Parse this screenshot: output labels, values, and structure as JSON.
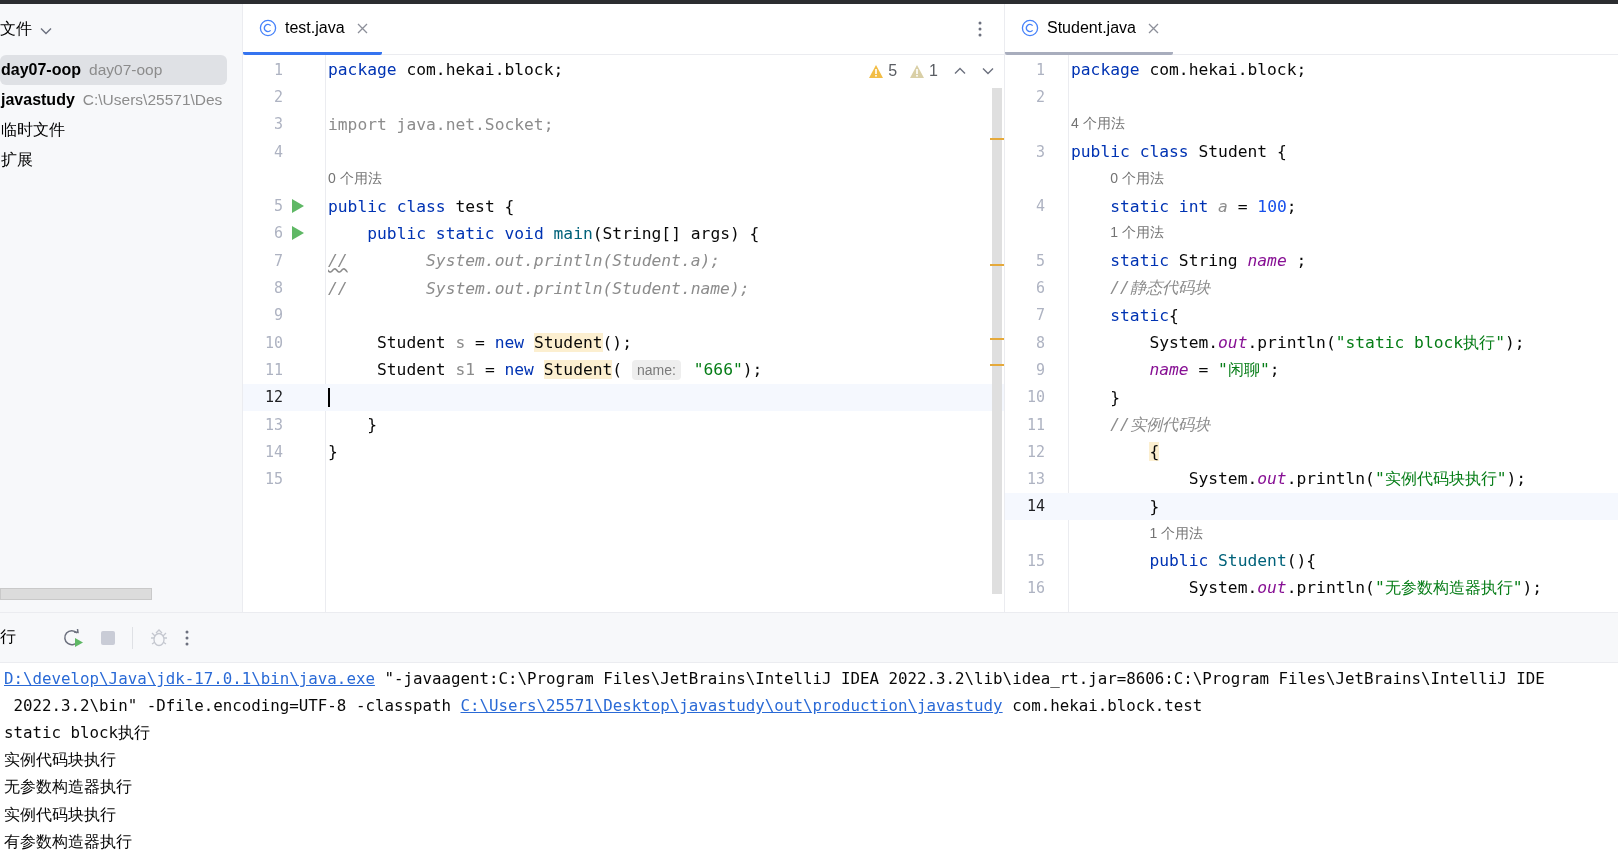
{
  "sidebar": {
    "title": "文件",
    "items": [
      {
        "name": "day07-oop",
        "detail": "day07-oop",
        "selected": true
      },
      {
        "name": "javastudy",
        "detail": "C:\\Users\\25571\\Des",
        "selected": false
      },
      {
        "name": "临时文件",
        "selected": false
      },
      {
        "name": "扩展",
        "selected": false
      }
    ]
  },
  "editors": [
    {
      "tab": {
        "label": "test.java",
        "focused": true
      },
      "inspections": {
        "warnings": "5",
        "weak_warnings": "1"
      },
      "lines": [
        {
          "kind": "code",
          "number": "1",
          "run": false,
          "current": false,
          "tokens": [
            {
              "kind": "keyword",
              "text": "package"
            },
            {
              "kind": "plain",
              "text": " com.hekai.block;"
            }
          ]
        },
        {
          "kind": "code",
          "number": "2",
          "run": false,
          "current": false
        },
        {
          "kind": "code",
          "number": "3",
          "run": false,
          "current": false,
          "tokens": [
            {
              "kind": "unused",
              "text": "import java.net.Socket;"
            }
          ]
        },
        {
          "kind": "code",
          "number": "4",
          "run": false,
          "current": false
        },
        {
          "kind": "usage",
          "text": "0 个用法"
        },
        {
          "kind": "code",
          "number": "5",
          "run": true,
          "current": false,
          "tokens": [
            {
              "kind": "keyword",
              "text": "public"
            },
            {
              "kind": "keyword",
              "text": " class"
            },
            {
              "kind": "plain",
              "text": " test {"
            }
          ]
        },
        {
          "kind": "code",
          "number": "6",
          "run": true,
          "current": false,
          "tokens": [
            {
              "kind": "keyword",
              "text": "    public"
            },
            {
              "kind": "keyword",
              "text": " static"
            },
            {
              "kind": "keyword",
              "text": " void"
            },
            {
              "kind": "method",
              "text": " main"
            },
            {
              "kind": "plain",
              "text": "(String[] args) {"
            }
          ]
        },
        {
          "kind": "code",
          "number": "7",
          "run": false,
          "current": false,
          "tokens": [
            {
              "kind": "comment_flagged",
              "text": "//"
            },
            {
              "kind": "comment",
              "text": "        System.out.println(Student.a);"
            }
          ]
        },
        {
          "kind": "code",
          "number": "8",
          "run": false,
          "current": false,
          "tokens": [
            {
              "kind": "comment",
              "text": "//        System.out.println(Student.name);"
            }
          ]
        },
        {
          "kind": "code",
          "number": "9",
          "run": false,
          "current": false
        },
        {
          "kind": "code",
          "number": "10",
          "run": false,
          "current": false,
          "tokens": [
            {
              "kind": "plain",
              "text": "     Student"
            },
            {
              "kind": "unused",
              "text": " s"
            },
            {
              "kind": "plain",
              "text": " ="
            },
            {
              "kind": "keyword",
              "text": " new"
            },
            {
              "kind": "match",
              "text": " Student"
            },
            {
              "kind": "plain",
              "text": "();"
            }
          ]
        },
        {
          "kind": "code",
          "number": "11",
          "run": false,
          "current": false,
          "tokens": [
            {
              "kind": "plain",
              "text": "     Student"
            },
            {
              "kind": "unused",
              "text": " s1"
            },
            {
              "kind": "plain",
              "text": " ="
            },
            {
              "kind": "keyword",
              "text": " new"
            },
            {
              "kind": "match",
              "text": " Student"
            },
            {
              "kind": "plain",
              "text": "("
            },
            {
              "kind": "hint",
              "text": " name:"
            },
            {
              "kind": "string",
              "text": " \"666\""
            },
            {
              "kind": "plain",
              "text": ");"
            }
          ]
        },
        {
          "kind": "code",
          "number": "12",
          "run": false,
          "current": true
        },
        {
          "kind": "code",
          "number": "13",
          "run": false,
          "current": false,
          "tokens": [
            {
              "kind": "plain",
              "text": "    }"
            }
          ]
        },
        {
          "kind": "code",
          "number": "14",
          "run": false,
          "current": false,
          "tokens": [
            {
              "kind": "plain",
              "text": "}"
            }
          ]
        },
        {
          "kind": "code",
          "number": "15",
          "run": false,
          "current": false
        }
      ]
    },
    {
      "tab": {
        "label": "Student.java",
        "focused": false
      },
      "lines": [
        {
          "kind": "code",
          "number": "1",
          "run": false,
          "current": false,
          "tokens": [
            {
              "kind": "keyword",
              "text": "package"
            },
            {
              "kind": "plain",
              "text": " com.hekai.block;"
            }
          ]
        },
        {
          "kind": "code",
          "number": "2",
          "run": false,
          "current": false
        },
        {
          "kind": "usage",
          "text": "4 个用法"
        },
        {
          "kind": "code",
          "number": "3",
          "run": false,
          "current": false,
          "tokens": [
            {
              "kind": "keyword",
              "text": "public"
            },
            {
              "kind": "keyword",
              "text": " class"
            },
            {
              "kind": "plain",
              "text": " Student {"
            }
          ]
        },
        {
          "kind": "usage",
          "text": "    0 个用法"
        },
        {
          "kind": "code",
          "number": "4",
          "run": false,
          "current": false,
          "tokens": [
            {
              "kind": "keyword",
              "text": "    static"
            },
            {
              "kind": "keyword",
              "text": " int"
            },
            {
              "kind": "field_unused",
              "text": " a"
            },
            {
              "kind": "plain",
              "text": " ="
            },
            {
              "kind": "number",
              "text": " 100"
            },
            {
              "kind": "plain",
              "text": ";"
            }
          ]
        },
        {
          "kind": "usage",
          "text": "    1 个用法"
        },
        {
          "kind": "code",
          "number": "5",
          "run": false,
          "current": false,
          "tokens": [
            {
              "kind": "keyword",
              "text": "    static"
            },
            {
              "kind": "plain",
              "text": " String"
            },
            {
              "kind": "field",
              "text": " name"
            },
            {
              "kind": "plain",
              "text": " ;"
            }
          ]
        },
        {
          "kind": "code",
          "number": "6",
          "run": false,
          "current": false,
          "tokens": [
            {
              "kind": "comment",
              "text": "    //静态代码块"
            }
          ]
        },
        {
          "kind": "code",
          "number": "7",
          "run": false,
          "current": false,
          "tokens": [
            {
              "kind": "keyword",
              "text": "    static"
            },
            {
              "kind": "plain",
              "text": "{"
            }
          ]
        },
        {
          "kind": "code",
          "number": "8",
          "run": false,
          "current": false,
          "tokens": [
            {
              "kind": "plain",
              "text": "        System."
            },
            {
              "kind": "field",
              "text": "out"
            },
            {
              "kind": "plain",
              "text": ".println("
            },
            {
              "kind": "string",
              "text": "\"static block执行\""
            },
            {
              "kind": "plain",
              "text": ");"
            }
          ]
        },
        {
          "kind": "code",
          "number": "9",
          "run": false,
          "current": false,
          "tokens": [
            {
              "kind": "field",
              "text": "        name"
            },
            {
              "kind": "plain",
              "text": " ="
            },
            {
              "kind": "string",
              "text": " \"闲聊\""
            },
            {
              "kind": "plain",
              "text": ";"
            }
          ]
        },
        {
          "kind": "code",
          "number": "10",
          "run": false,
          "current": false,
          "tokens": [
            {
              "kind": "plain",
              "text": "    }"
            }
          ]
        },
        {
          "kind": "code",
          "number": "11",
          "run": false,
          "current": false,
          "tokens": [
            {
              "kind": "comment",
              "text": "    //实例代码块"
            }
          ]
        },
        {
          "kind": "code",
          "number": "12",
          "run": false,
          "current": false,
          "tokens": [
            {
              "kind": "match",
              "text": "        {"
            }
          ]
        },
        {
          "kind": "code",
          "number": "13",
          "run": false,
          "current": false,
          "tokens": [
            {
              "kind": "plain",
              "text": "            System."
            },
            {
              "kind": "field",
              "text": "out"
            },
            {
              "kind": "plain",
              "text": ".println("
            },
            {
              "kind": "string",
              "text": "\"实例代码块执行\""
            },
            {
              "kind": "plain",
              "text": ");"
            }
          ]
        },
        {
          "kind": "code",
          "number": "14",
          "run": false,
          "current": true,
          "tokens": [
            {
              "kind": "plain",
              "text": "        }"
            }
          ]
        },
        {
          "kind": "usage",
          "text": "        1 个用法"
        },
        {
          "kind": "code",
          "number": "15",
          "run": false,
          "current": false,
          "tokens": [
            {
              "kind": "keyword",
              "text": "        public"
            },
            {
              "kind": "method",
              "text": " Student"
            },
            {
              "kind": "plain",
              "text": "(){"
            }
          ]
        },
        {
          "kind": "code",
          "number": "16",
          "run": false,
          "current": false,
          "tokens": [
            {
              "kind": "plain",
              "text": "            System."
            },
            {
              "kind": "field",
              "text": "out"
            },
            {
              "kind": "plain",
              "text": ".println("
            },
            {
              "kind": "string",
              "text": "\"无参数构造器执行\""
            },
            {
              "kind": "plain",
              "text": ");"
            }
          ]
        }
      ]
    }
  ],
  "run_panel": {
    "title": "行",
    "console": [
      [
        {
          "kind": "link",
          "text": "D:\\develop\\Java\\jdk-17.0.1\\bin\\java.exe"
        },
        {
          "kind": "plain",
          "text": " \"-javaagent:C:\\Program Files\\JetBrains\\IntelliJ IDEA 2022.3.2\\lib\\idea_rt.jar=8606:C:\\Program Files\\JetBrains\\IntelliJ IDE"
        }
      ],
      [
        {
          "kind": "plain",
          "text": " 2022.3.2\\bin\" -Dfile.encoding=UTF-8 -classpath"
        },
        {
          "kind": "link",
          "text": " C:\\Users\\25571\\Desktop\\javastudy\\out\\production\\javastudy"
        },
        {
          "kind": "plain",
          "text": " com.hekai.block.test"
        }
      ],
      [
        {
          "kind": "plain",
          "text": "static block执行"
        }
      ],
      [
        {
          "kind": "plain",
          "text": "实例代码块执行"
        }
      ],
      [
        {
          "kind": "plain",
          "text": "无参数构造器执行"
        }
      ],
      [
        {
          "kind": "plain",
          "text": "实例代码块执行"
        }
      ],
      [
        {
          "kind": "plain",
          "text": "有参数构造器执行"
        }
      ]
    ]
  }
}
